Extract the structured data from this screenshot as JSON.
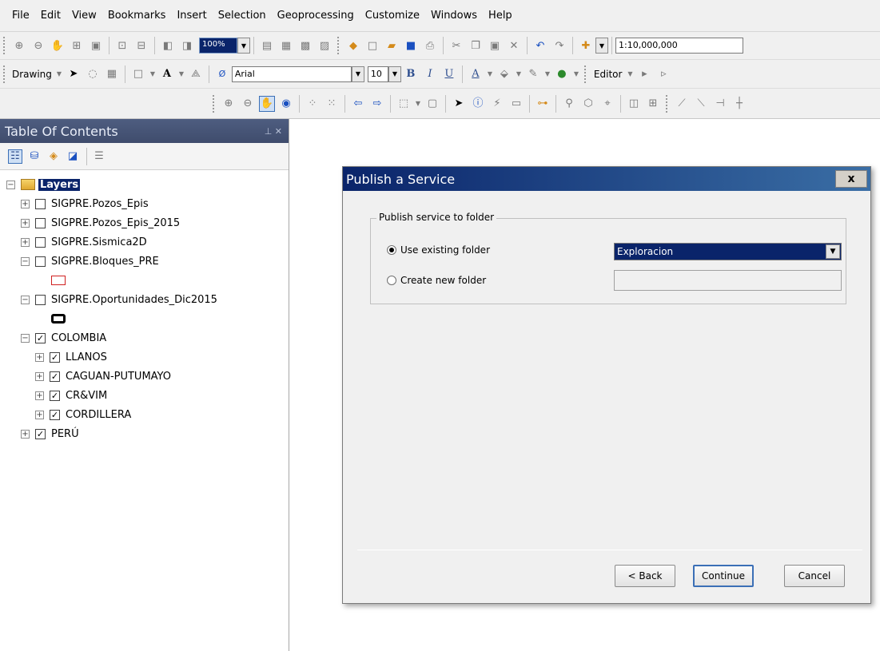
{
  "menu": [
    "File",
    "Edit",
    "View",
    "Bookmarks",
    "Insert",
    "Selection",
    "Geoprocessing",
    "Customize",
    "Windows",
    "Help"
  ],
  "toolbar": {
    "zoom_value": "100%",
    "scale_value": "1:10,000,000",
    "drawing_label": "Drawing",
    "font_value": "Arial",
    "font_size": "10",
    "bold_label": "B",
    "italic_label": "I",
    "underline_label": "U",
    "font_color_label": "A",
    "editor_label": "Editor"
  },
  "toc": {
    "title": "Table Of Contents",
    "root_label": "Layers",
    "layers": [
      {
        "name": "SIGPRE.Pozos_Epis",
        "checked": false
      },
      {
        "name": "SIGPRE.Pozos_Epis_2015",
        "checked": false
      },
      {
        "name": "SIGPRE.Sismica2D",
        "checked": false
      },
      {
        "name": "SIGPRE.Bloques_PRE",
        "checked": false
      },
      {
        "name": "SIGPRE.Oportunidades_Dic2015",
        "checked": false
      },
      {
        "name": "COLOMBIA",
        "checked": true
      },
      {
        "name": "LLANOS",
        "checked": true
      },
      {
        "name": "CAGUAN-PUTUMAYO",
        "checked": true
      },
      {
        "name": "CR&VIM",
        "checked": true
      },
      {
        "name": "CORDILLERA",
        "checked": true
      },
      {
        "name": "PERÚ",
        "checked": true
      }
    ]
  },
  "dialog": {
    "title": "Publish a Service",
    "close_label": "x",
    "group_label": "Publish service to folder",
    "option_existing": "Use existing folder",
    "option_new": "Create new folder",
    "selected_option": "existing",
    "folder_value": "Exploracion",
    "new_folder_value": "",
    "back_label": "< Back",
    "continue_label": "Continue",
    "cancel_label": "Cancel"
  }
}
